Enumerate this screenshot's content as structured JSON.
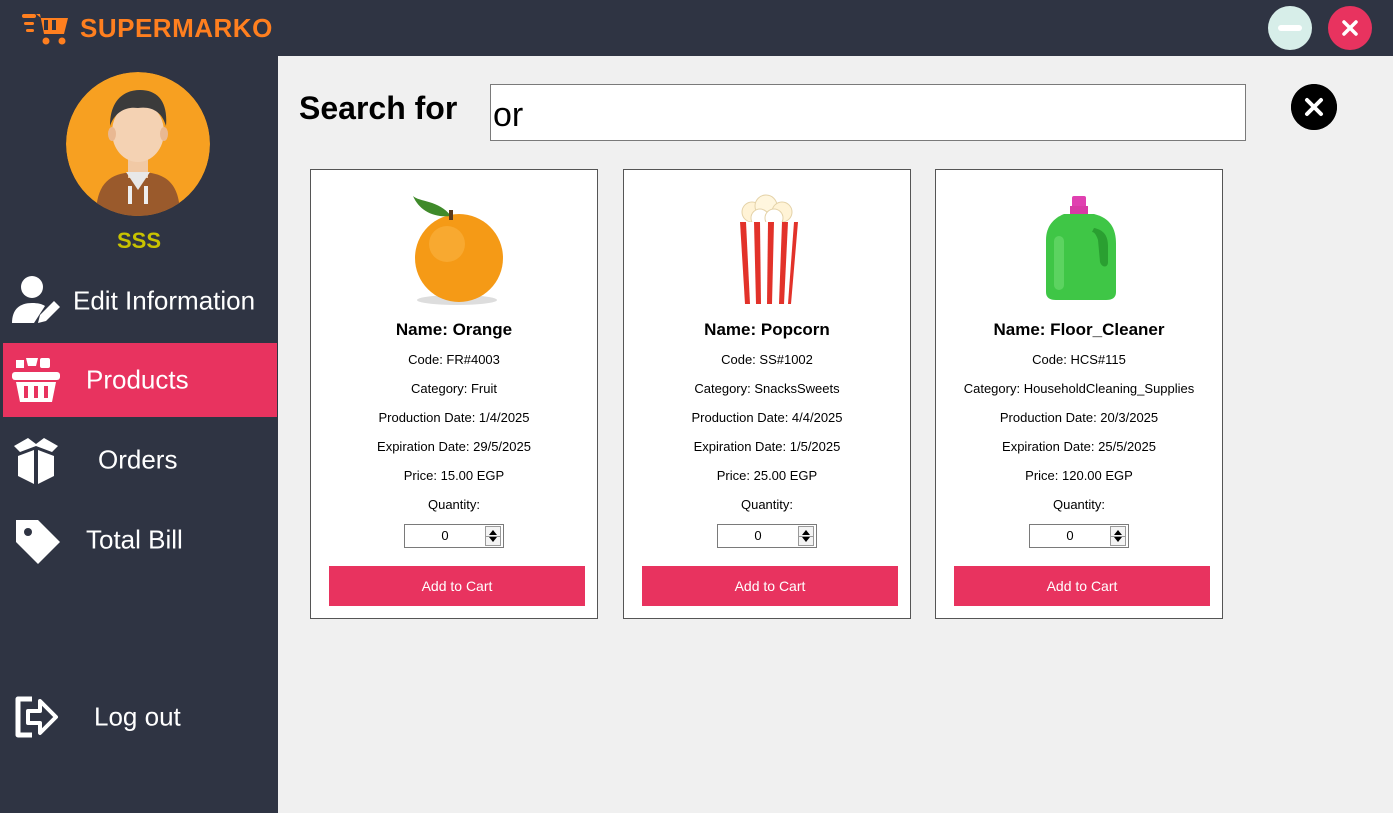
{
  "app": {
    "title": "SUPERMARKO",
    "accent_color": "#e8335f",
    "title_color": "#ff7f1f",
    "sidebar_color": "#2f3443",
    "logo_icon": "shopping-cart-icon"
  },
  "window_controls": {
    "minimize_icon": "minimize-icon",
    "close_icon": "close-icon"
  },
  "user": {
    "name": "SSS",
    "avatar_icon": "user-avatar"
  },
  "sidebar": {
    "items": [
      {
        "label": "Edit Information",
        "icon": "user-edit-icon",
        "active": false
      },
      {
        "label": "Products",
        "icon": "basket-icon",
        "active": true
      },
      {
        "label": "Orders",
        "icon": "box-icon",
        "active": false
      },
      {
        "label": "Total Bill",
        "icon": "price-tag-icon",
        "active": false
      }
    ],
    "logout": {
      "label": "Log out",
      "icon": "logout-icon"
    }
  },
  "search": {
    "label": "Search for",
    "value": "or",
    "clear_icon": "clear-search-icon"
  },
  "products": [
    {
      "name": "Name: Orange",
      "code": "Code: FR#4003",
      "category": "Category: Fruit",
      "production": "Production Date: 1/4/2025",
      "expiration": "Expiration Date: 29/5/2025",
      "price": "Price: 15.00 EGP",
      "quantity_label": "Quantity:",
      "quantity": "0",
      "button": "Add to Cart",
      "image": "orange-image"
    },
    {
      "name": "Name: Popcorn",
      "code": "Code: SS#1002",
      "category": "Category: SnacksSweets",
      "production": "Production Date: 4/4/2025",
      "expiration": "Expiration Date: 1/5/2025",
      "price": "Price: 25.00 EGP",
      "quantity_label": "Quantity:",
      "quantity": "0",
      "button": "Add to Cart",
      "image": "popcorn-image"
    },
    {
      "name": "Name: Floor_Cleaner",
      "code": "Code: HCS#115",
      "category": "Category: HouseholdCleaning_Supplies",
      "production": "Production Date: 20/3/2025",
      "expiration": "Expiration Date: 25/5/2025",
      "price": "Price: 120.00 EGP",
      "quantity_label": "Quantity:",
      "quantity": "0",
      "button": "Add to Cart",
      "image": "cleaner-bottle-image"
    }
  ]
}
